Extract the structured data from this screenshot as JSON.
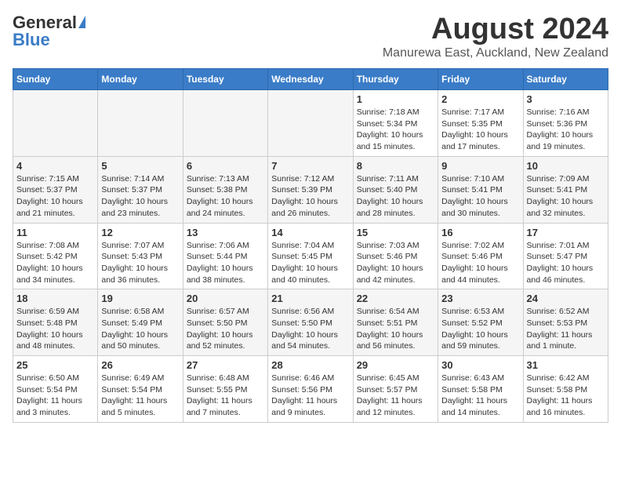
{
  "header": {
    "logo_general": "General",
    "logo_blue": "Blue",
    "month_title": "August 2024",
    "location": "Manurewa East, Auckland, New Zealand"
  },
  "days_of_week": [
    "Sunday",
    "Monday",
    "Tuesday",
    "Wednesday",
    "Thursday",
    "Friday",
    "Saturday"
  ],
  "weeks": [
    [
      {
        "day": "",
        "info": ""
      },
      {
        "day": "",
        "info": ""
      },
      {
        "day": "",
        "info": ""
      },
      {
        "day": "",
        "info": ""
      },
      {
        "day": "1",
        "info": "Sunrise: 7:18 AM\nSunset: 5:34 PM\nDaylight: 10 hours\nand 15 minutes."
      },
      {
        "day": "2",
        "info": "Sunrise: 7:17 AM\nSunset: 5:35 PM\nDaylight: 10 hours\nand 17 minutes."
      },
      {
        "day": "3",
        "info": "Sunrise: 7:16 AM\nSunset: 5:36 PM\nDaylight: 10 hours\nand 19 minutes."
      }
    ],
    [
      {
        "day": "4",
        "info": "Sunrise: 7:15 AM\nSunset: 5:37 PM\nDaylight: 10 hours\nand 21 minutes."
      },
      {
        "day": "5",
        "info": "Sunrise: 7:14 AM\nSunset: 5:37 PM\nDaylight: 10 hours\nand 23 minutes."
      },
      {
        "day": "6",
        "info": "Sunrise: 7:13 AM\nSunset: 5:38 PM\nDaylight: 10 hours\nand 24 minutes."
      },
      {
        "day": "7",
        "info": "Sunrise: 7:12 AM\nSunset: 5:39 PM\nDaylight: 10 hours\nand 26 minutes."
      },
      {
        "day": "8",
        "info": "Sunrise: 7:11 AM\nSunset: 5:40 PM\nDaylight: 10 hours\nand 28 minutes."
      },
      {
        "day": "9",
        "info": "Sunrise: 7:10 AM\nSunset: 5:41 PM\nDaylight: 10 hours\nand 30 minutes."
      },
      {
        "day": "10",
        "info": "Sunrise: 7:09 AM\nSunset: 5:41 PM\nDaylight: 10 hours\nand 32 minutes."
      }
    ],
    [
      {
        "day": "11",
        "info": "Sunrise: 7:08 AM\nSunset: 5:42 PM\nDaylight: 10 hours\nand 34 minutes."
      },
      {
        "day": "12",
        "info": "Sunrise: 7:07 AM\nSunset: 5:43 PM\nDaylight: 10 hours\nand 36 minutes."
      },
      {
        "day": "13",
        "info": "Sunrise: 7:06 AM\nSunset: 5:44 PM\nDaylight: 10 hours\nand 38 minutes."
      },
      {
        "day": "14",
        "info": "Sunrise: 7:04 AM\nSunset: 5:45 PM\nDaylight: 10 hours\nand 40 minutes."
      },
      {
        "day": "15",
        "info": "Sunrise: 7:03 AM\nSunset: 5:46 PM\nDaylight: 10 hours\nand 42 minutes."
      },
      {
        "day": "16",
        "info": "Sunrise: 7:02 AM\nSunset: 5:46 PM\nDaylight: 10 hours\nand 44 minutes."
      },
      {
        "day": "17",
        "info": "Sunrise: 7:01 AM\nSunset: 5:47 PM\nDaylight: 10 hours\nand 46 minutes."
      }
    ],
    [
      {
        "day": "18",
        "info": "Sunrise: 6:59 AM\nSunset: 5:48 PM\nDaylight: 10 hours\nand 48 minutes."
      },
      {
        "day": "19",
        "info": "Sunrise: 6:58 AM\nSunset: 5:49 PM\nDaylight: 10 hours\nand 50 minutes."
      },
      {
        "day": "20",
        "info": "Sunrise: 6:57 AM\nSunset: 5:50 PM\nDaylight: 10 hours\nand 52 minutes."
      },
      {
        "day": "21",
        "info": "Sunrise: 6:56 AM\nSunset: 5:50 PM\nDaylight: 10 hours\nand 54 minutes."
      },
      {
        "day": "22",
        "info": "Sunrise: 6:54 AM\nSunset: 5:51 PM\nDaylight: 10 hours\nand 56 minutes."
      },
      {
        "day": "23",
        "info": "Sunrise: 6:53 AM\nSunset: 5:52 PM\nDaylight: 10 hours\nand 59 minutes."
      },
      {
        "day": "24",
        "info": "Sunrise: 6:52 AM\nSunset: 5:53 PM\nDaylight: 11 hours\nand 1 minute."
      }
    ],
    [
      {
        "day": "25",
        "info": "Sunrise: 6:50 AM\nSunset: 5:54 PM\nDaylight: 11 hours\nand 3 minutes."
      },
      {
        "day": "26",
        "info": "Sunrise: 6:49 AM\nSunset: 5:54 PM\nDaylight: 11 hours\nand 5 minutes."
      },
      {
        "day": "27",
        "info": "Sunrise: 6:48 AM\nSunset: 5:55 PM\nDaylight: 11 hours\nand 7 minutes."
      },
      {
        "day": "28",
        "info": "Sunrise: 6:46 AM\nSunset: 5:56 PM\nDaylight: 11 hours\nand 9 minutes."
      },
      {
        "day": "29",
        "info": "Sunrise: 6:45 AM\nSunset: 5:57 PM\nDaylight: 11 hours\nand 12 minutes."
      },
      {
        "day": "30",
        "info": "Sunrise: 6:43 AM\nSunset: 5:58 PM\nDaylight: 11 hours\nand 14 minutes."
      },
      {
        "day": "31",
        "info": "Sunrise: 6:42 AM\nSunset: 5:58 PM\nDaylight: 11 hours\nand 16 minutes."
      }
    ]
  ]
}
